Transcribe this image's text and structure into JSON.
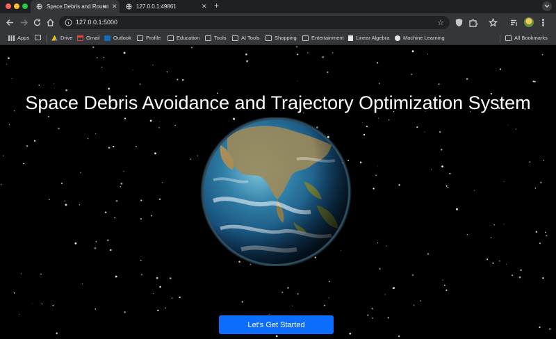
{
  "browser": {
    "tabs": [
      {
        "title": "Space Debris and Route O",
        "active": true
      },
      {
        "title": "127.0.0.1:49861",
        "active": false
      }
    ],
    "new_tab_label": "+",
    "address": "127.0.0.1:5000",
    "bookmarks": [
      {
        "label": "Apps",
        "icon": "apps-grid-icon"
      },
      {
        "label": "",
        "icon": "grid-icon"
      },
      {
        "label": "Drive",
        "icon": "drive-icon"
      },
      {
        "label": "Gmail",
        "icon": "gmail-icon"
      },
      {
        "label": "Outlook",
        "icon": "outlook-icon"
      },
      {
        "label": "Profile",
        "icon": "folder-icon"
      },
      {
        "label": "Education",
        "icon": "folder-icon"
      },
      {
        "label": "Tools",
        "icon": "folder-icon"
      },
      {
        "label": "AI Tools",
        "icon": "folder-icon"
      },
      {
        "label": "Shopping",
        "icon": "folder-icon"
      },
      {
        "label": "Entertainment",
        "icon": "folder-icon"
      },
      {
        "label": "Linear Algebra",
        "icon": "site-icon"
      },
      {
        "label": "Machine Learning",
        "icon": "google-icon"
      }
    ],
    "all_bookmarks_label": "All Bookmarks"
  },
  "page": {
    "title": "Space Debris Avoidance and Trajectory Optimization System",
    "cta_label": "Let's Get Started"
  },
  "colors": {
    "background": "#000000",
    "cta": "#0d6efd",
    "chrome_dark": "#1f2023",
    "chrome": "#35363a"
  }
}
